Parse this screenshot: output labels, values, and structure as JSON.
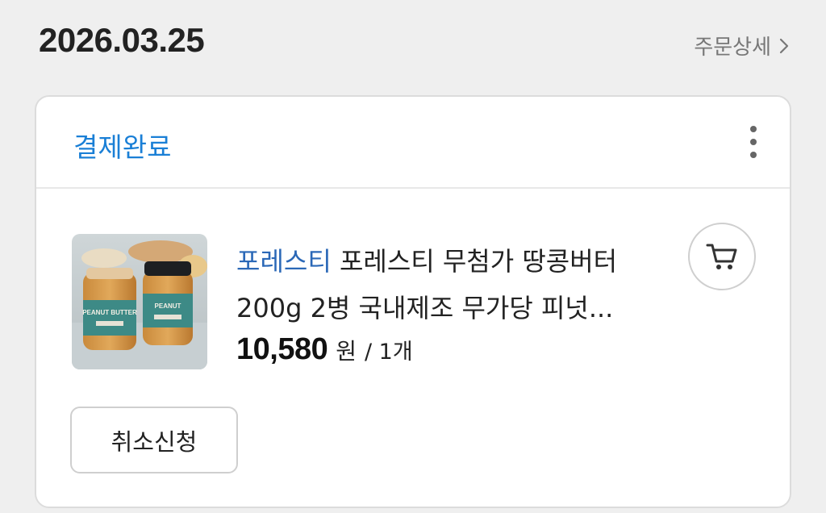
{
  "order": {
    "date": "2026.03.25",
    "detail_link_label": "주문상세",
    "status": "결제완료"
  },
  "product": {
    "seller": "포레스티",
    "name": "포레스티 무첨가 땅콩버터 200g 2병 국내제조 무가당 피넛...",
    "price": "10,580",
    "price_unit": "원",
    "quantity": "/ 1개",
    "image_text": "PEANUT BUTTER"
  },
  "actions": {
    "cancel_label": "취소신청"
  },
  "icons": {
    "detail_chevron": "chevron-right-icon",
    "more": "more-vertical-icon",
    "cart": "cart-icon"
  },
  "colors": {
    "status": "#1a7fd6",
    "seller": "#2b68b7",
    "background": "#efefef"
  }
}
